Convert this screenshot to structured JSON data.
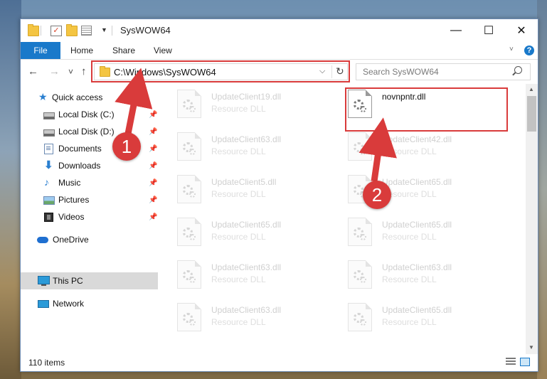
{
  "window": {
    "title": "SysWOW64",
    "controls": {
      "minimize": "—",
      "maximize": "☐",
      "close": "✕"
    }
  },
  "ribbon": {
    "tabs": [
      "File",
      "Home",
      "Share",
      "View"
    ],
    "help": "?"
  },
  "nav": {
    "back": "←",
    "forward": "→",
    "recent": "˅",
    "up": "↑",
    "address": "C:\\Windows\\SysWOW64",
    "search_placeholder": "Search SysWOW64"
  },
  "sidebar": {
    "items": [
      {
        "label": "Quick access",
        "icon": "star-icon",
        "pinned": false
      },
      {
        "label": "Local Disk (C:)",
        "icon": "drive-icon",
        "pinned": true
      },
      {
        "label": "Local Disk (D:)",
        "icon": "drive-icon",
        "pinned": true
      },
      {
        "label": "Documents",
        "icon": "documents-icon",
        "pinned": true
      },
      {
        "label": "Downloads",
        "icon": "downloads-icon",
        "pinned": true
      },
      {
        "label": "Music",
        "icon": "music-icon",
        "pinned": true
      },
      {
        "label": "Pictures",
        "icon": "pictures-icon",
        "pinned": true
      },
      {
        "label": "Videos",
        "icon": "videos-icon",
        "pinned": true
      },
      {
        "label": "OneDrive",
        "icon": "onedrive-icon",
        "pinned": false
      },
      {
        "label": "This PC",
        "icon": "this-pc-icon",
        "pinned": false,
        "selected": true
      },
      {
        "label": "Network",
        "icon": "network-icon",
        "pinned": false
      }
    ]
  },
  "files": [
    {
      "name": "UpdateClient19.dll",
      "type": "Resource DLL"
    },
    {
      "name": "novnpntr.dll",
      "type": "",
      "highlighted": true
    },
    {
      "name": "UpdateClient63.dll",
      "type": "Resource DLL"
    },
    {
      "name": "UpdateClient42.dll",
      "type": "Resource DLL"
    },
    {
      "name": "UpdateClient5.dll",
      "type": "Resource DLL"
    },
    {
      "name": "UpdateClient65.dll",
      "type": "Resource DLL"
    },
    {
      "name": "UpdateClient65.dll",
      "type": "Resource DLL"
    },
    {
      "name": "UpdateClient65.dll",
      "type": "Resource DLL"
    },
    {
      "name": "UpdateClient63.dll",
      "type": "Resource DLL"
    },
    {
      "name": "UpdateClient63.dll",
      "type": "Resource DLL"
    },
    {
      "name": "UpdateClient63.dll",
      "type": "Resource DLL"
    },
    {
      "name": "UpdateClient65.dll",
      "type": "Resource DLL"
    }
  ],
  "status": {
    "item_count": "110 items"
  },
  "callouts": [
    "1",
    "2"
  ],
  "colors": {
    "accent": "#1979ca",
    "callout": "#d93b3b",
    "selected_nav": "#d9d9d9"
  }
}
